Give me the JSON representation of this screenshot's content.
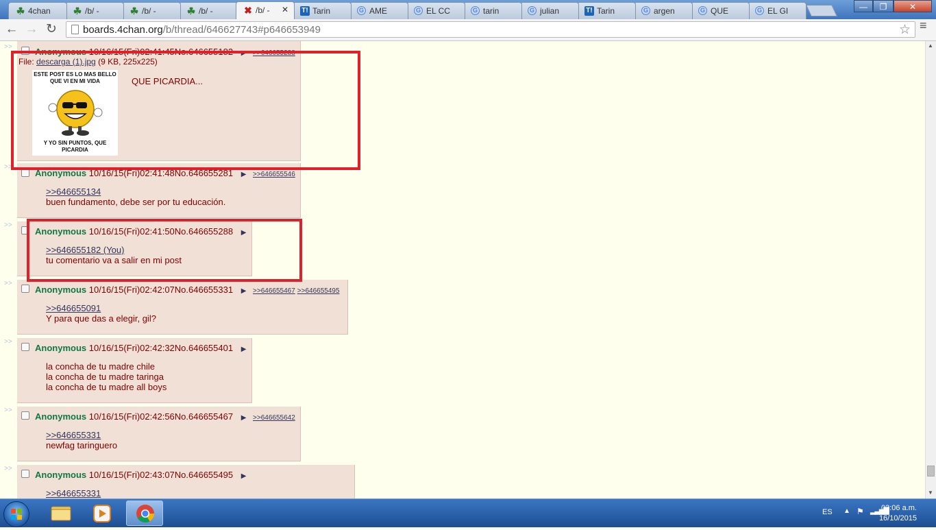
{
  "browser": {
    "tabs": [
      {
        "title": "4chan",
        "icon": "clover-icon",
        "active": false
      },
      {
        "title": "/b/ -",
        "icon": "clover-icon",
        "active": false
      },
      {
        "title": "/b/ -",
        "icon": "clover-icon",
        "active": false
      },
      {
        "title": "/b/ -",
        "icon": "clover-icon",
        "active": false
      },
      {
        "title": "/b/ -",
        "icon": "red-x-icon",
        "active": true
      },
      {
        "title": "Tarin",
        "icon": "taringa-icon",
        "active": false
      },
      {
        "title": "AME",
        "icon": "google-icon",
        "active": false
      },
      {
        "title": "EL CC",
        "icon": "google-icon",
        "active": false
      },
      {
        "title": "tarin",
        "icon": "google-icon",
        "active": false
      },
      {
        "title": "julian",
        "icon": "google-icon",
        "active": false
      },
      {
        "title": "Tarin",
        "icon": "taringa-icon",
        "active": false
      },
      {
        "title": "argen",
        "icon": "google-icon",
        "active": false
      },
      {
        "title": "QUE",
        "icon": "google-icon",
        "active": false
      },
      {
        "title": "EL GI",
        "icon": "google-icon",
        "active": false
      }
    ],
    "url_host": "boards.4chan.org",
    "url_path": "/b/thread/646627743#p646653949"
  },
  "posts": [
    {
      "name": "Anonymous",
      "date": "10/16/15(Fri)02:41:45",
      "no": "No.646655182",
      "backlinks": [
        ">>646655288"
      ],
      "file_label": "File:",
      "file_name": "descarga (1).jpg",
      "file_meta": "(9 KB, 225x225)",
      "thumb_top": "ESTE POST ES LO MAS BELLO QUE VI EN MI VIDA",
      "thumb_bottom": "Y YO SIN PUNTOS, QUE PICARDIA",
      "lines": [
        "QUE PICARDIA..."
      ]
    },
    {
      "name": "Anonymous",
      "date": "10/16/15(Fri)02:41:48",
      "no": "No.646655281",
      "backlinks": [
        ">>646655546"
      ],
      "quote": ">>646655134",
      "lines": [
        "buen fundamento, debe ser por tu educación."
      ]
    },
    {
      "name": "Anonymous",
      "date": "10/16/15(Fri)02:41:50",
      "no": "No.646655288",
      "backlinks": [],
      "quote": ">>646655182 (You)",
      "lines": [
        "tu comentario va a salir en mi post"
      ]
    },
    {
      "name": "Anonymous",
      "date": "10/16/15(Fri)02:42:07",
      "no": "No.646655331",
      "backlinks": [
        ">>646655467",
        ">>646655495"
      ],
      "quote": ">>646655091",
      "lines": [
        "Y para que das a elegir, gil?"
      ]
    },
    {
      "name": "Anonymous",
      "date": "10/16/15(Fri)02:42:32",
      "no": "No.646655401",
      "backlinks": [],
      "lines": [
        "la concha de tu madre chile",
        "la concha de tu madre taringa",
        "la concha de tu madre all boys"
      ]
    },
    {
      "name": "Anonymous",
      "date": "10/16/15(Fri)02:42:56",
      "no": "No.646655467",
      "backlinks": [
        ">>646655642"
      ],
      "quote": ">>646655331",
      "lines": [
        "newfag taringuero"
      ]
    },
    {
      "name": "Anonymous",
      "date": "10/16/15(Fri)02:43:07",
      "no": "No.646655495",
      "backlinks": [],
      "quote": ">>646655331",
      "lines": []
    }
  ],
  "arrows_text": ">>",
  "taskbar": {
    "lang": "ES",
    "time": "03:06 a.m.",
    "date": "16/10/2015"
  }
}
